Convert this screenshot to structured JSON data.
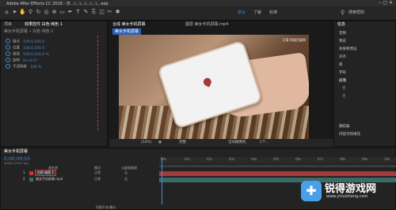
{
  "titlebar": {
    "title": "Adobe After Effects CC 2018 - 日…\\…\\…\\…\\…\\…aep"
  },
  "toolbar": {
    "workspace": "默认",
    "learn": "了解",
    "standard": "标准",
    "search_label": "搜索帮助"
  },
  "left_panel": {
    "tabs": [
      "项目",
      "效果控件 白色 纯色 1"
    ],
    "layer_path": "美女手机屏幕 • 白色 纯色 1",
    "props": [
      {
        "name": "锚点",
        "value": "100.0,100.0"
      },
      {
        "name": "位置",
        "value": "100.0,100.0"
      },
      {
        "name": "缩放",
        "value": "100.0,100.0 %"
      },
      {
        "name": "旋转",
        "value": "0x+0.0°"
      },
      {
        "name": "不透明度",
        "value": "100 %"
      }
    ]
  },
  "comp_panel": {
    "tab": "合成 美女手机屏幕",
    "tab2": "图层 美女手机屏幕.mp4",
    "subtab": "美女手机屏幕",
    "watermark": "正版 知道百度网",
    "zoom": "(50%)",
    "res": "完整",
    "camera": "活动摄像机",
    "views": "1个..."
  },
  "right_panel": {
    "title": "信息",
    "items": [
      "音频",
      "预览",
      "效果和预设",
      "对齐",
      "库",
      "字符",
      "段落",
      "跟踪器",
      "内容识别填充"
    ],
    "para_value": "无",
    "font_size": "无"
  },
  "timeline": {
    "tab": "美女手机屏幕",
    "timecode": "0;00;00;03",
    "frames": "00003 (29.97 fps)",
    "col_source": "源名称",
    "col_mode": "模式",
    "col_parent": "父级和链接",
    "layers": [
      {
        "num": "1",
        "name": "白色 纯色 1",
        "mode": "正常",
        "parent": "无"
      },
      {
        "num": "2",
        "name": "美女手机屏幕.mp4",
        "mode": "正常",
        "parent": "无"
      }
    ],
    "ruler": [
      "00s",
      "01s",
      "02s",
      "03s",
      "04s",
      "05s",
      "06s",
      "07s",
      "08s",
      "09s",
      "10s"
    ],
    "bottom": "切换开关/模式"
  },
  "watermark_logo": {
    "name": "锐得游戏网",
    "url": "www.ytruisheng.com"
  },
  "colors": {
    "accent_blue": "#4a8ad8",
    "selection_red": "#d23232",
    "layer_red": "#a33b3b",
    "layer_teal": "#3a6b6b"
  }
}
